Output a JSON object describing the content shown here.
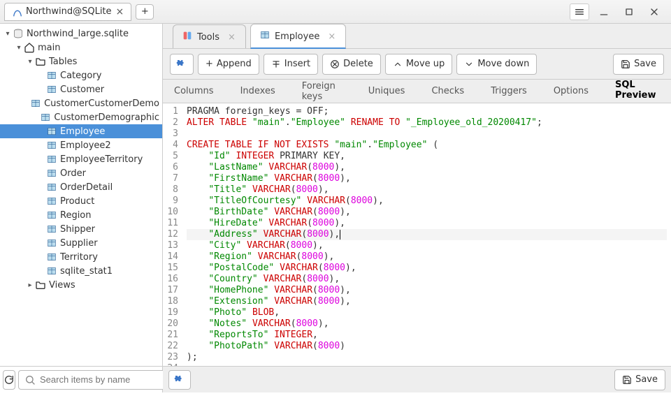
{
  "window": {
    "title": "Northwind@SQLite"
  },
  "tree": {
    "root": "Northwind_large.sqlite",
    "schema": "main",
    "tables_label": "Tables",
    "views_label": "Views",
    "tables": [
      "Category",
      "Customer",
      "CustomerCustomerDemo",
      "CustomerDemographic",
      "Employee",
      "Employee2",
      "EmployeeTerritory",
      "Order",
      "OrderDetail",
      "Product",
      "Region",
      "Shipper",
      "Supplier",
      "Territory",
      "sqlite_stat1"
    ],
    "selected": "Employee"
  },
  "editor_tabs": {
    "tools": "Tools",
    "employee": "Employee"
  },
  "toolbar": {
    "append": "Append",
    "insert": "Insert",
    "delete": "Delete",
    "moveup": "Move up",
    "movedown": "Move down",
    "save": "Save"
  },
  "subtabs": {
    "columns": "Columns",
    "indexes": "Indexes",
    "fk": "Foreign keys",
    "uniques": "Uniques",
    "checks": "Checks",
    "triggers": "Triggers",
    "options": "Options",
    "preview": "SQL Preview"
  },
  "search": {
    "placeholder": "Search items by name"
  },
  "sql": {
    "current_line": 12,
    "lines": [
      [
        {
          "t": "PRAGMA foreign_keys = OFF;",
          "c": ""
        }
      ],
      [
        {
          "t": "ALTER TABLE",
          "c": "kw"
        },
        {
          "t": " ",
          "c": ""
        },
        {
          "t": "\"main\"",
          "c": "str"
        },
        {
          "t": ".",
          "c": ""
        },
        {
          "t": "\"Employee\"",
          "c": "str"
        },
        {
          "t": " ",
          "c": ""
        },
        {
          "t": "RENAME TO",
          "c": "kw"
        },
        {
          "t": " ",
          "c": ""
        },
        {
          "t": "\"_Employee_old_20200417\"",
          "c": "str"
        },
        {
          "t": ";",
          "c": ""
        }
      ],
      [],
      [
        {
          "t": "CREATE TABLE IF NOT EXISTS",
          "c": "kw"
        },
        {
          "t": " ",
          "c": ""
        },
        {
          "t": "\"main\"",
          "c": "str"
        },
        {
          "t": ".",
          "c": ""
        },
        {
          "t": "\"Employee\"",
          "c": "str"
        },
        {
          "t": " (",
          "c": ""
        }
      ],
      [
        {
          "t": "    ",
          "c": ""
        },
        {
          "t": "\"Id\"",
          "c": "str"
        },
        {
          "t": " ",
          "c": ""
        },
        {
          "t": "INTEGER",
          "c": "kw"
        },
        {
          "t": " PRIMARY KEY,",
          "c": ""
        }
      ],
      [
        {
          "t": "    ",
          "c": ""
        },
        {
          "t": "\"LastName\"",
          "c": "str"
        },
        {
          "t": " ",
          "c": ""
        },
        {
          "t": "VARCHAR",
          "c": "kw"
        },
        {
          "t": "(",
          "c": ""
        },
        {
          "t": "8000",
          "c": "num"
        },
        {
          "t": "),",
          "c": ""
        }
      ],
      [
        {
          "t": "    ",
          "c": ""
        },
        {
          "t": "\"FirstName\"",
          "c": "str"
        },
        {
          "t": " ",
          "c": ""
        },
        {
          "t": "VARCHAR",
          "c": "kw"
        },
        {
          "t": "(",
          "c": ""
        },
        {
          "t": "8000",
          "c": "num"
        },
        {
          "t": "),",
          "c": ""
        }
      ],
      [
        {
          "t": "    ",
          "c": ""
        },
        {
          "t": "\"Title\"",
          "c": "str"
        },
        {
          "t": " ",
          "c": ""
        },
        {
          "t": "VARCHAR",
          "c": "kw"
        },
        {
          "t": "(",
          "c": ""
        },
        {
          "t": "8000",
          "c": "num"
        },
        {
          "t": "),",
          "c": ""
        }
      ],
      [
        {
          "t": "    ",
          "c": ""
        },
        {
          "t": "\"TitleOfCourtesy\"",
          "c": "str"
        },
        {
          "t": " ",
          "c": ""
        },
        {
          "t": "VARCHAR",
          "c": "kw"
        },
        {
          "t": "(",
          "c": ""
        },
        {
          "t": "8000",
          "c": "num"
        },
        {
          "t": "),",
          "c": ""
        }
      ],
      [
        {
          "t": "    ",
          "c": ""
        },
        {
          "t": "\"BirthDate\"",
          "c": "str"
        },
        {
          "t": " ",
          "c": ""
        },
        {
          "t": "VARCHAR",
          "c": "kw"
        },
        {
          "t": "(",
          "c": ""
        },
        {
          "t": "8000",
          "c": "num"
        },
        {
          "t": "),",
          "c": ""
        }
      ],
      [
        {
          "t": "    ",
          "c": ""
        },
        {
          "t": "\"HireDate\"",
          "c": "str"
        },
        {
          "t": " ",
          "c": ""
        },
        {
          "t": "VARCHAR",
          "c": "kw"
        },
        {
          "t": "(",
          "c": ""
        },
        {
          "t": "8000",
          "c": "num"
        },
        {
          "t": "),",
          "c": ""
        }
      ],
      [
        {
          "t": "    ",
          "c": ""
        },
        {
          "t": "\"Address\"",
          "c": "str"
        },
        {
          "t": " ",
          "c": ""
        },
        {
          "t": "VARCHAR",
          "c": "kw"
        },
        {
          "t": "(",
          "c": ""
        },
        {
          "t": "8000",
          "c": "num"
        },
        {
          "t": "),",
          "c": ""
        }
      ],
      [
        {
          "t": "    ",
          "c": ""
        },
        {
          "t": "\"City\"",
          "c": "str"
        },
        {
          "t": " ",
          "c": ""
        },
        {
          "t": "VARCHAR",
          "c": "kw"
        },
        {
          "t": "(",
          "c": ""
        },
        {
          "t": "8000",
          "c": "num"
        },
        {
          "t": "),",
          "c": ""
        }
      ],
      [
        {
          "t": "    ",
          "c": ""
        },
        {
          "t": "\"Region\"",
          "c": "str"
        },
        {
          "t": " ",
          "c": ""
        },
        {
          "t": "VARCHAR",
          "c": "kw"
        },
        {
          "t": "(",
          "c": ""
        },
        {
          "t": "8000",
          "c": "num"
        },
        {
          "t": "),",
          "c": ""
        }
      ],
      [
        {
          "t": "    ",
          "c": ""
        },
        {
          "t": "\"PostalCode\"",
          "c": "str"
        },
        {
          "t": " ",
          "c": ""
        },
        {
          "t": "VARCHAR",
          "c": "kw"
        },
        {
          "t": "(",
          "c": ""
        },
        {
          "t": "8000",
          "c": "num"
        },
        {
          "t": "),",
          "c": ""
        }
      ],
      [
        {
          "t": "    ",
          "c": ""
        },
        {
          "t": "\"Country\"",
          "c": "str"
        },
        {
          "t": " ",
          "c": ""
        },
        {
          "t": "VARCHAR",
          "c": "kw"
        },
        {
          "t": "(",
          "c": ""
        },
        {
          "t": "8000",
          "c": "num"
        },
        {
          "t": "),",
          "c": ""
        }
      ],
      [
        {
          "t": "    ",
          "c": ""
        },
        {
          "t": "\"HomePhone\"",
          "c": "str"
        },
        {
          "t": " ",
          "c": ""
        },
        {
          "t": "VARCHAR",
          "c": "kw"
        },
        {
          "t": "(",
          "c": ""
        },
        {
          "t": "8000",
          "c": "num"
        },
        {
          "t": "),",
          "c": ""
        }
      ],
      [
        {
          "t": "    ",
          "c": ""
        },
        {
          "t": "\"Extension\"",
          "c": "str"
        },
        {
          "t": " ",
          "c": ""
        },
        {
          "t": "VARCHAR",
          "c": "kw"
        },
        {
          "t": "(",
          "c": ""
        },
        {
          "t": "8000",
          "c": "num"
        },
        {
          "t": "),",
          "c": ""
        }
      ],
      [
        {
          "t": "    ",
          "c": ""
        },
        {
          "t": "\"Photo\"",
          "c": "str"
        },
        {
          "t": " ",
          "c": ""
        },
        {
          "t": "BLOB",
          "c": "kw"
        },
        {
          "t": ",",
          "c": ""
        }
      ],
      [
        {
          "t": "    ",
          "c": ""
        },
        {
          "t": "\"Notes\"",
          "c": "str"
        },
        {
          "t": " ",
          "c": ""
        },
        {
          "t": "VARCHAR",
          "c": "kw"
        },
        {
          "t": "(",
          "c": ""
        },
        {
          "t": "8000",
          "c": "num"
        },
        {
          "t": "),",
          "c": ""
        }
      ],
      [
        {
          "t": "    ",
          "c": ""
        },
        {
          "t": "\"ReportsTo\"",
          "c": "str"
        },
        {
          "t": " ",
          "c": ""
        },
        {
          "t": "INTEGER",
          "c": "kw"
        },
        {
          "t": ",",
          "c": ""
        }
      ],
      [
        {
          "t": "    ",
          "c": ""
        },
        {
          "t": "\"PhotoPath\"",
          "c": "str"
        },
        {
          "t": " ",
          "c": ""
        },
        {
          "t": "VARCHAR",
          "c": "kw"
        },
        {
          "t": "(",
          "c": ""
        },
        {
          "t": "8000",
          "c": "num"
        },
        {
          "t": ")",
          "c": ""
        }
      ],
      [
        {
          "t": ");",
          "c": ""
        }
      ],
      [],
      []
    ]
  }
}
